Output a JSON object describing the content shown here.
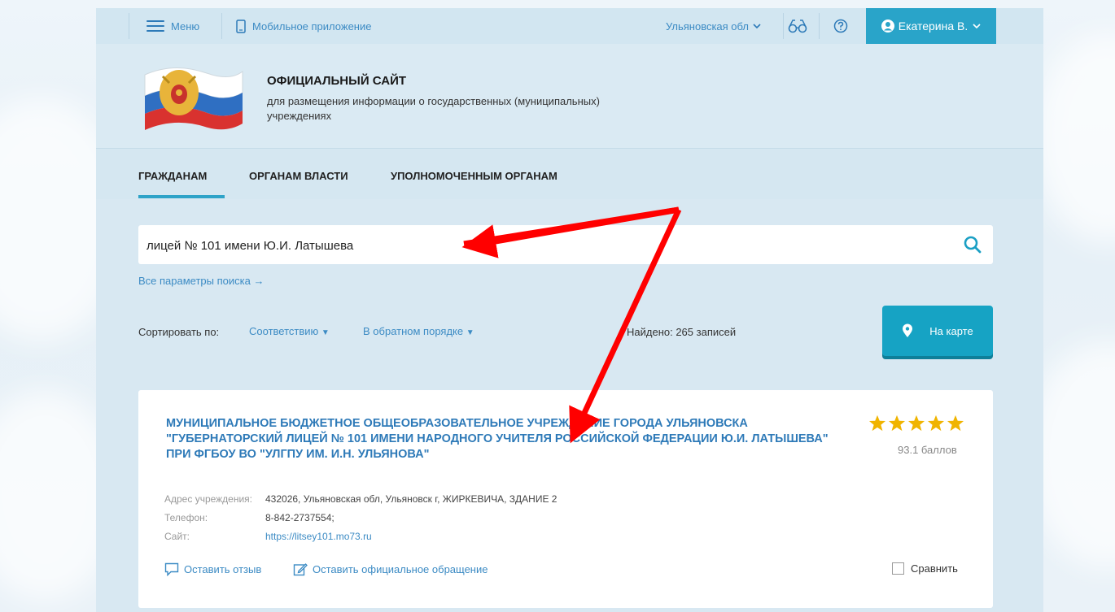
{
  "topbar": {
    "menu_label": "Меню",
    "mobile_label": "Мобильное приложение",
    "region": "Ульяновская обл",
    "user_name": "Екатерина В."
  },
  "header": {
    "title": "ОФИЦИАЛЬНЫЙ САЙТ",
    "subtitle": "для размещения информации о государственных (муниципальных) учреждениях"
  },
  "nav": {
    "items": [
      "ГРАЖДАНАМ",
      "ОРГАНАМ ВЛАСТИ",
      "УПОЛНОМОЧЕННЫМ ОРГАНАМ"
    ]
  },
  "search": {
    "value": "лицей № 101 имени Ю.И. Латышева",
    "all_params": "Все параметры поиска →"
  },
  "sort": {
    "label": "Сортировать по:",
    "option1": "Соответствию",
    "option2": "В обратном порядке",
    "found": "Найдено: 265 записей",
    "map_button": "На карте"
  },
  "result": {
    "title": "МУНИЦИПАЛЬНОЕ БЮДЖЕТНОЕ ОБЩЕОБРАЗОВАТЕЛЬНОЕ УЧРЕЖДЕНИЕ ГОРОДА УЛЬЯНОВСКА \"ГУБЕРНАТОРСКИЙ ЛИЦЕЙ № 101 ИМЕНИ НАРОДНОГО УЧИТЕЛЯ РОССИЙСКОЙ ФЕДЕРАЦИИ Ю.И. ЛАТЫШЕВА\" ПРИ ФГБОУ ВО \"УЛГПУ ИМ. И.Н. УЛЬЯНОВА\"",
    "rating_stars": 5,
    "score": "93.1 баллов",
    "address_label": "Адрес учреждения:",
    "address": "432026, Ульяновская обл, Ульяновск г, ЖИРКЕВИЧА, ЗДАНИЕ 2",
    "phone_label": "Телефон:",
    "phone": "8-842-2737554;",
    "site_label": "Сайт:",
    "site": "https://litsey101.mo73.ru",
    "review_action": "Оставить отзыв",
    "appeal_action": "Оставить официальное обращение",
    "compare_label": "Сравнить"
  },
  "colors": {
    "accent": "#29a4c9",
    "link": "#3c8bc4",
    "star": "#f0b400",
    "annotation_arrow": "#ff0000"
  }
}
